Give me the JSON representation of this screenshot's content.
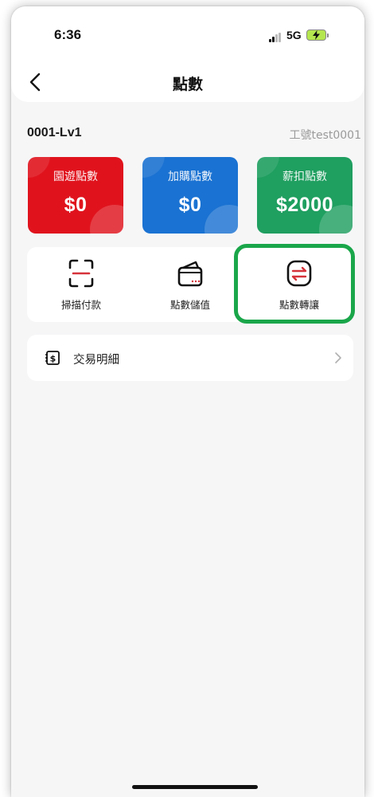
{
  "status_bar": {
    "time": "6:36",
    "network": "5G"
  },
  "header": {
    "title": "點數"
  },
  "account": {
    "id": "0001-Lv1",
    "staff": "工號test0001"
  },
  "cards": [
    {
      "label": "園遊點數",
      "value": "$0",
      "color": "#e0131d"
    },
    {
      "label": "加購點數",
      "value": "$0",
      "color": "#1a72d2"
    },
    {
      "label": "薪扣點數",
      "value": "$2000",
      "color": "#1f9f60"
    }
  ],
  "actions": [
    {
      "label": "掃描付款",
      "icon": "scan-icon"
    },
    {
      "label": "點數儲值",
      "icon": "wallet-icon"
    },
    {
      "label": "點數轉讓",
      "icon": "transfer-icon"
    }
  ],
  "transactions": {
    "label": "交易明細",
    "icon": "receipt-icon"
  },
  "colors": {
    "accent_red": "#d6323a",
    "highlight_green": "#1aa64a",
    "background": "#f6f6f7"
  }
}
